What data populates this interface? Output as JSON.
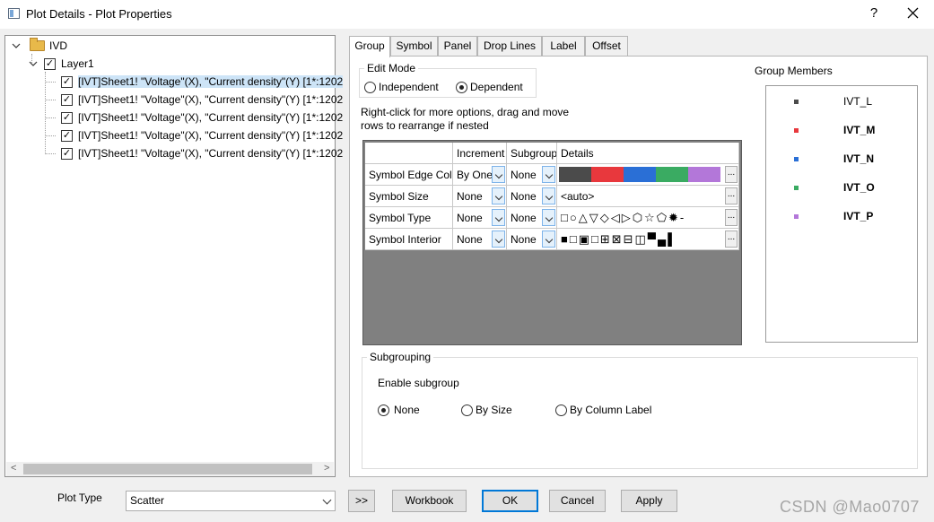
{
  "window": {
    "title": "Plot Details - Plot Properties",
    "help_label": "?"
  },
  "tree": {
    "root_label": "IVD",
    "layer_label": "Layer1",
    "datasets": [
      "[IVT]Sheet1! \"Voltage\"(X), \"Current density\"(Y) [1*:1202",
      "[IVT]Sheet1! \"Voltage\"(X), \"Current density\"(Y) [1*:1202",
      "[IVT]Sheet1! \"Voltage\"(X), \"Current density\"(Y) [1*:1202",
      "[IVT]Sheet1! \"Voltage\"(X), \"Current density\"(Y) [1*:1202",
      "[IVT]Sheet1! \"Voltage\"(X), \"Current density\"(Y) [1*:1202"
    ]
  },
  "tabs": [
    "Group",
    "Symbol",
    "Panel",
    "Drop Lines",
    "Label",
    "Offset"
  ],
  "active_tab": "Group",
  "edit_mode": {
    "legend": "Edit Mode",
    "options": [
      "Independent",
      "Dependent"
    ],
    "selected": "Dependent"
  },
  "hint_text": "Right-click for more options, drag and move\nrows to  rearrange if nested",
  "grid": {
    "headers": [
      "",
      "Increment",
      "Subgroup",
      "Details"
    ],
    "rows": [
      {
        "label": "Symbol Edge Color",
        "increment": "By One",
        "subgroup": "None",
        "details": "",
        "details_kind": "colors"
      },
      {
        "label": "Symbol Size",
        "increment": "None",
        "subgroup": "None",
        "details": "<auto>",
        "details_kind": "text"
      },
      {
        "label": "Symbol Type",
        "increment": "None",
        "subgroup": "None",
        "details": "□○△▽◇◁▷⬡☆⬠✹-",
        "details_kind": "symbols"
      },
      {
        "label": "Symbol Interior",
        "increment": "None",
        "subgroup": "None",
        "details": "■□▣□⊞⊠⊟◫▀▄▌",
        "details_kind": "interiors"
      }
    ],
    "edge_colors": [
      "#4b4b4b",
      "#e8383d",
      "#2a6fd6",
      "#3aab62",
      "#b377d9"
    ],
    "ellipsis": "..."
  },
  "group_members": {
    "label": "Group Members",
    "items": [
      {
        "name": "IVT_L",
        "color": "#4b4b4b",
        "bold": false
      },
      {
        "name": "IVT_M",
        "color": "#e8383d",
        "bold": true
      },
      {
        "name": "IVT_N",
        "color": "#2a6fd6",
        "bold": true
      },
      {
        "name": "IVT_O",
        "color": "#3aab62",
        "bold": true
      },
      {
        "name": "IVT_P",
        "color": "#b377d9",
        "bold": true
      }
    ]
  },
  "subgrouping": {
    "legend": "Subgrouping",
    "enable_label": "Enable subgroup",
    "options": [
      "None",
      "By Size",
      "By Column Label"
    ],
    "selected": "None"
  },
  "bottom": {
    "plot_type_label": "Plot Type",
    "plot_type_value": "Scatter",
    "more_button": ">>",
    "workbook_button": "Workbook",
    "ok_button": "OK",
    "cancel_button": "Cancel",
    "apply_button": "Apply"
  },
  "watermark": "CSDN @Mao0707"
}
